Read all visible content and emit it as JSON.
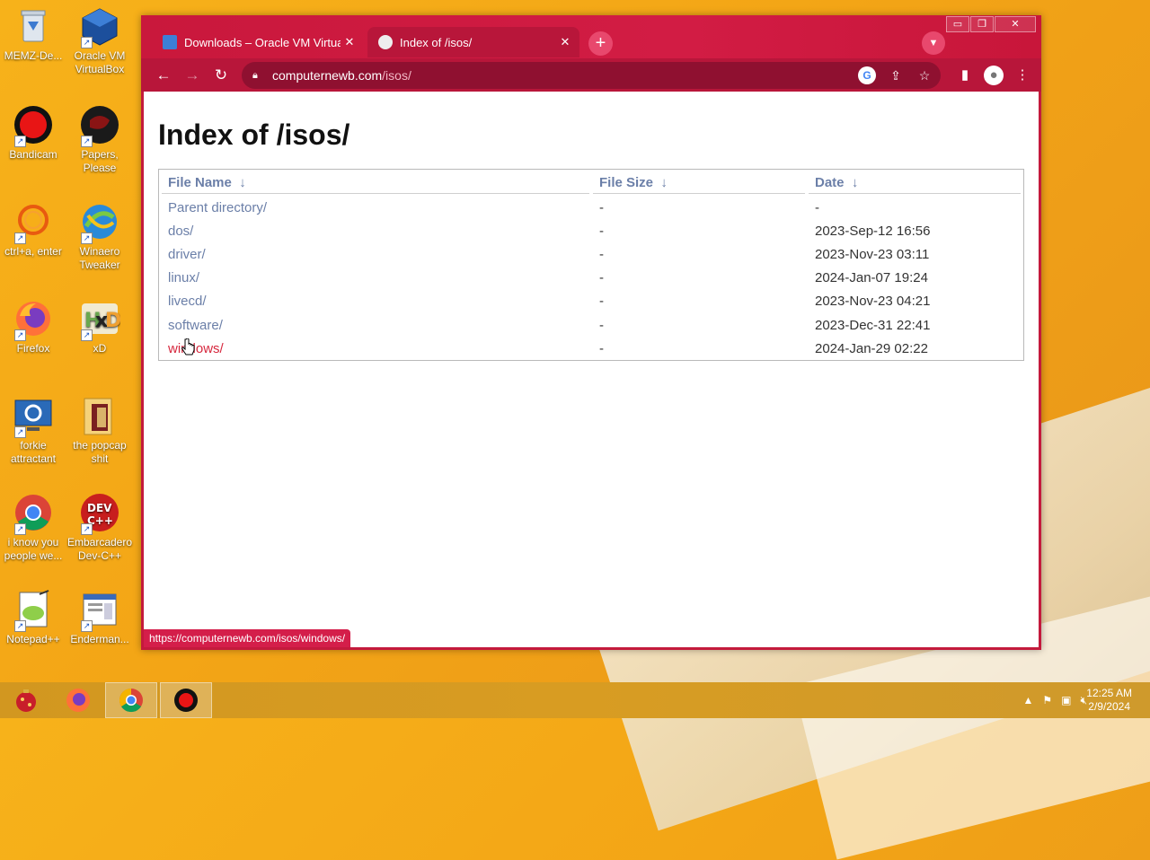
{
  "desktop": {
    "icons": [
      {
        "label": "MEMZ-De...",
        "icon": "recycle-bin-icon"
      },
      {
        "label": "Oracle VM VirtualBox",
        "icon": "virtualbox-icon"
      },
      {
        "label": "Bandicam",
        "icon": "bandicam-icon"
      },
      {
        "label": "Papers, Please",
        "icon": "papers-please-icon"
      },
      {
        "label": "ctrl+a, enter",
        "icon": "ring-icon"
      },
      {
        "label": "Winaero Tweaker",
        "icon": "winaero-icon"
      },
      {
        "label": "Firefox",
        "icon": "firefox-icon"
      },
      {
        "label": "xD",
        "icon": "hxd-icon"
      },
      {
        "label": "forkie attractant",
        "icon": "settings-monitor-icon"
      },
      {
        "label": "the popcap shit",
        "icon": "folder-icon"
      },
      {
        "label": "i know you people we...",
        "icon": "chrome-icon"
      },
      {
        "label": "Embarcadero Dev-C++",
        "icon": "devcpp-icon"
      },
      {
        "label": "Notepad++",
        "icon": "notepadpp-icon"
      },
      {
        "label": "Enderman...",
        "icon": "document-icon"
      }
    ]
  },
  "browser": {
    "tabs": [
      {
        "title": "Downloads – Oracle VM VirtualB",
        "close": "✕"
      },
      {
        "title": "Index of /isos/",
        "close": "✕"
      }
    ],
    "new_tab": "+",
    "address": {
      "domain": "computernewb.com",
      "path": "/isos/"
    },
    "status_url": "https://computernewb.com/isos/windows/",
    "window_controls": {
      "minimize": "▭",
      "restore": "❐",
      "close": "✕"
    }
  },
  "page": {
    "title": "Index of /isos/",
    "columns": {
      "name": "File Name",
      "size": "File Size",
      "date": "Date",
      "sort_arrow": "↓"
    },
    "rows": [
      {
        "name": "Parent directory/",
        "size": "-",
        "date": "-"
      },
      {
        "name": "dos/",
        "size": "-",
        "date": "2023-Sep-12 16:56"
      },
      {
        "name": "driver/",
        "size": "-",
        "date": "2023-Nov-23 03:11"
      },
      {
        "name": "linux/",
        "size": "-",
        "date": "2024-Jan-07 19:24"
      },
      {
        "name": "livecd/",
        "size": "-",
        "date": "2023-Nov-23 04:21"
      },
      {
        "name": "software/",
        "size": "-",
        "date": "2023-Dec-31 22:41"
      },
      {
        "name": "windows/",
        "size": "-",
        "date": "2024-Jan-29 02:22"
      }
    ]
  },
  "taskbar": {
    "clock_time": "12:25 AM",
    "clock_date": "2/9/2024",
    "tray_chevron": "▲"
  },
  "colors": {
    "browser_frame": "#c41a3c",
    "link": "#6b7fa8",
    "link_hover": "#d6283e",
    "taskbar": "#d29720"
  }
}
